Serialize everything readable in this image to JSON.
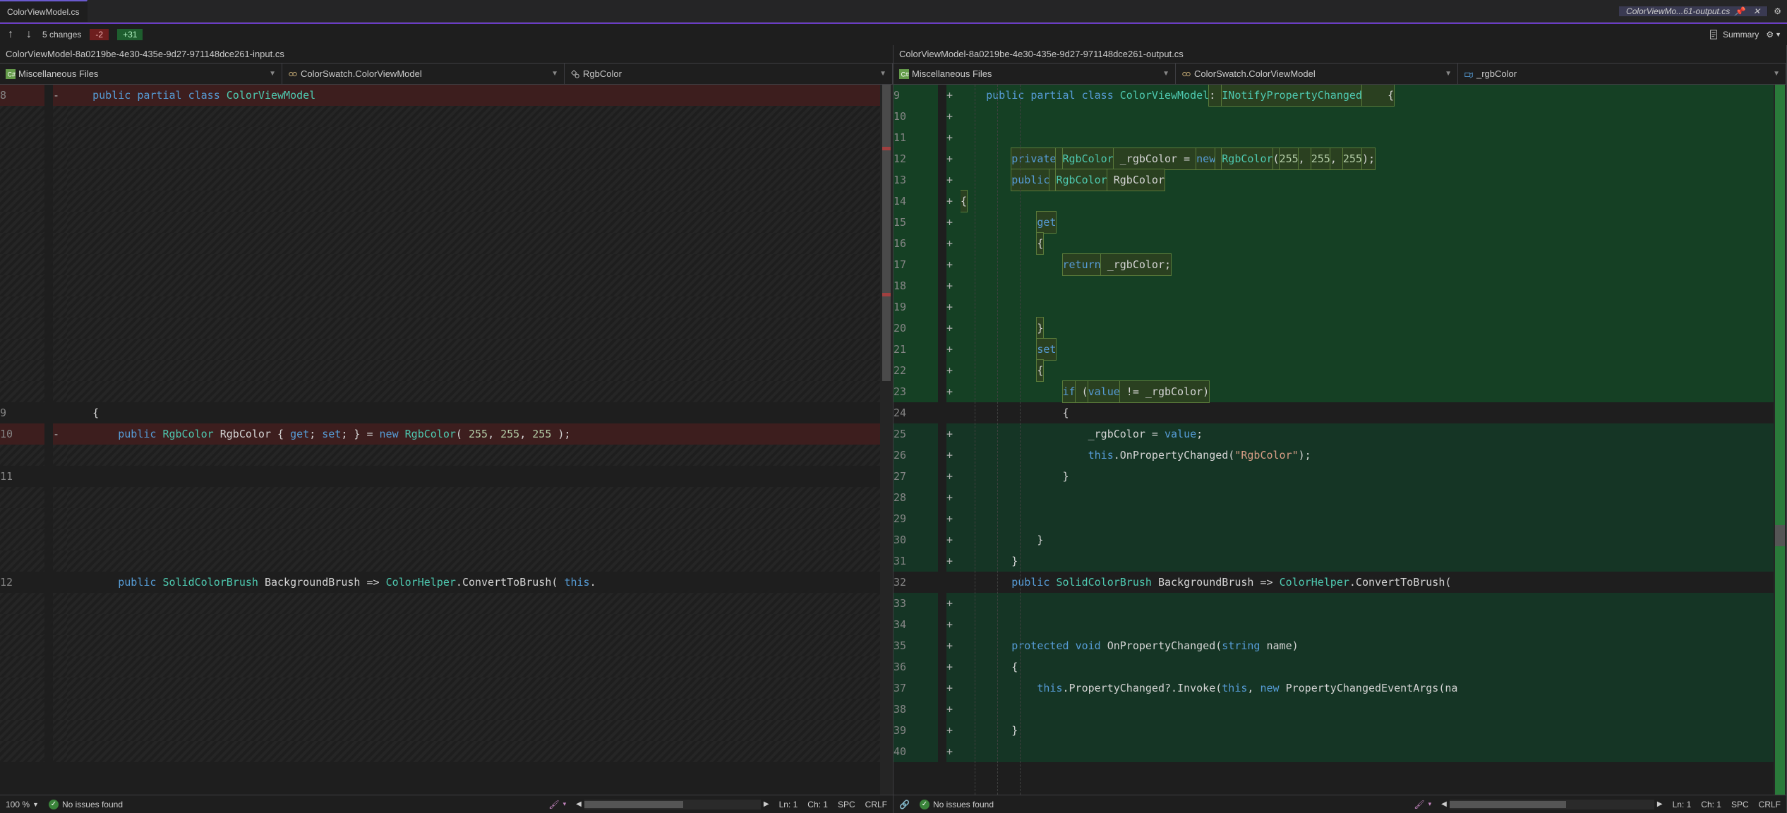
{
  "tabs": {
    "left": {
      "label": "ColorViewModel.cs"
    },
    "right": {
      "label": "ColorViewMo...61-output.cs"
    }
  },
  "toolbar": {
    "changes": "5 changes",
    "removed": "-2",
    "added": "+31",
    "summary": "Summary"
  },
  "headers": {
    "left": "ColorViewModel-8a0219be-4e30-435e-9d27-971148dce261-input.cs",
    "right": "ColorViewModel-8a0219be-4e30-435e-9d27-971148dce261-output.cs"
  },
  "crumbs": {
    "left": {
      "project": "Miscellaneous Files",
      "class": "ColorSwatch.ColorViewModel",
      "member": "RgbColor"
    },
    "right": {
      "project": "Miscellaneous Files",
      "class": "ColorSwatch.ColorViewModel",
      "member": "_rgbColor"
    }
  },
  "left_lines": [
    {
      "n": "8",
      "m": "-",
      "cls": "removed",
      "tokens": [
        [
          "    ",
          ""
        ],
        [
          "public",
          "kw"
        ],
        [
          " ",
          ""
        ],
        [
          "partial",
          "kw"
        ],
        [
          " ",
          ""
        ],
        [
          "class",
          "kw"
        ],
        [
          " ",
          ""
        ],
        [
          "ColorViewModel",
          "type"
        ]
      ]
    },
    {
      "n": "",
      "m": "",
      "cls": "hatch",
      "tokens": []
    },
    {
      "n": "",
      "m": "",
      "cls": "hatch",
      "tokens": []
    },
    {
      "n": "",
      "m": "",
      "cls": "hatch",
      "tokens": []
    },
    {
      "n": "",
      "m": "",
      "cls": "hatch",
      "tokens": []
    },
    {
      "n": "",
      "m": "",
      "cls": "hatch",
      "tokens": []
    },
    {
      "n": "",
      "m": "",
      "cls": "hatch",
      "tokens": []
    },
    {
      "n": "",
      "m": "",
      "cls": "hatch",
      "tokens": []
    },
    {
      "n": "",
      "m": "",
      "cls": "hatch",
      "tokens": []
    },
    {
      "n": "",
      "m": "",
      "cls": "hatch",
      "tokens": []
    },
    {
      "n": "",
      "m": "",
      "cls": "hatch",
      "tokens": []
    },
    {
      "n": "",
      "m": "",
      "cls": "hatch",
      "tokens": []
    },
    {
      "n": "",
      "m": "",
      "cls": "hatch",
      "tokens": []
    },
    {
      "n": "",
      "m": "",
      "cls": "hatch",
      "tokens": []
    },
    {
      "n": "",
      "m": "",
      "cls": "hatch",
      "tokens": []
    },
    {
      "n": "9",
      "m": "",
      "cls": "neutral",
      "tokens": [
        [
          "    {",
          "plain"
        ]
      ]
    },
    {
      "n": "10",
      "m": "-",
      "cls": "removed",
      "tokens": [
        [
          "        ",
          ""
        ],
        [
          "public",
          "kw"
        ],
        [
          " ",
          ""
        ],
        [
          "RgbColor",
          "type"
        ],
        [
          " ",
          ""
        ],
        [
          "RgbColor",
          "plain"
        ],
        [
          " { ",
          "plain"
        ],
        [
          "get",
          "kw"
        ],
        [
          "; ",
          "plain"
        ],
        [
          "set",
          "kw"
        ],
        [
          "; } = ",
          "plain"
        ],
        [
          "new",
          "kw"
        ],
        [
          " ",
          ""
        ],
        [
          "RgbColor",
          "type"
        ],
        [
          "( ",
          "plain"
        ],
        [
          "255",
          "num"
        ],
        [
          ", ",
          "plain"
        ],
        [
          "255",
          "num"
        ],
        [
          ", ",
          "plain"
        ],
        [
          "255",
          "num"
        ],
        [
          " );",
          "plain"
        ]
      ]
    },
    {
      "n": "",
      "m": "",
      "cls": "hatch",
      "tokens": []
    },
    {
      "n": "11",
      "m": "",
      "cls": "neutral",
      "tokens": []
    },
    {
      "n": "",
      "m": "",
      "cls": "hatch",
      "tokens": []
    },
    {
      "n": "",
      "m": "",
      "cls": "hatch",
      "tokens": []
    },
    {
      "n": "",
      "m": "",
      "cls": "hatch",
      "tokens": []
    },
    {
      "n": "",
      "m": "",
      "cls": "hatch",
      "tokens": []
    },
    {
      "n": "12",
      "m": "",
      "cls": "neutral",
      "tokens": [
        [
          "        ",
          ""
        ],
        [
          "public",
          "kw"
        ],
        [
          " ",
          ""
        ],
        [
          "SolidColorBrush",
          "type"
        ],
        [
          " ",
          ""
        ],
        [
          "BackgroundBrush",
          "plain"
        ],
        [
          " => ",
          "plain"
        ],
        [
          "ColorHelper",
          "type"
        ],
        [
          ".",
          "plain"
        ],
        [
          "ConvertToBrush",
          "plain"
        ],
        [
          "( ",
          "plain"
        ],
        [
          "this",
          "kw"
        ],
        [
          ".",
          "plain"
        ]
      ]
    },
    {
      "n": "",
      "m": "",
      "cls": "hatch",
      "tokens": []
    },
    {
      "n": "",
      "m": "",
      "cls": "hatch",
      "tokens": []
    },
    {
      "n": "",
      "m": "",
      "cls": "hatch",
      "tokens": []
    },
    {
      "n": "",
      "m": "",
      "cls": "hatch",
      "tokens": []
    },
    {
      "n": "",
      "m": "",
      "cls": "hatch",
      "tokens": []
    },
    {
      "n": "",
      "m": "",
      "cls": "hatch",
      "tokens": []
    },
    {
      "n": "",
      "m": "",
      "cls": "hatch",
      "tokens": []
    },
    {
      "n": "",
      "m": "",
      "cls": "hatch",
      "tokens": []
    }
  ],
  "right_lines": [
    {
      "n": "9",
      "m": "+",
      "cls": "added",
      "tokens": [
        [
          "    ",
          ""
        ],
        [
          "public",
          "kw"
        ],
        [
          " ",
          ""
        ],
        [
          "partial",
          "kw"
        ],
        [
          " ",
          ""
        ],
        [
          "class",
          "kw"
        ],
        [
          " ",
          ""
        ],
        [
          "ColorViewModel",
          "type"
        ],
        [
          ": ",
          "hl"
        ],
        [
          "INotifyPropertyChanged",
          "hl-type"
        ],
        [
          "    {",
          "hl"
        ]
      ]
    },
    {
      "n": "10",
      "m": "+",
      "cls": "added",
      "tokens": []
    },
    {
      "n": "11",
      "m": "+",
      "cls": "added",
      "tokens": []
    },
    {
      "n": "12",
      "m": "+",
      "cls": "added",
      "tokens": [
        [
          "        ",
          ""
        ],
        [
          "private",
          "hl-kw"
        ],
        [
          " ",
          "hl"
        ],
        [
          "RgbColor",
          "hl-type"
        ],
        [
          " _rgbColor = ",
          "hl"
        ],
        [
          "new",
          "hl-kw"
        ],
        [
          " ",
          "hl"
        ],
        [
          "RgbColor",
          "hl-type"
        ],
        [
          "(",
          "hl"
        ],
        [
          "255",
          "hl-num"
        ],
        [
          ", ",
          "hl"
        ],
        [
          "255",
          "hl-num"
        ],
        [
          ", ",
          "hl"
        ],
        [
          "255",
          "hl-num"
        ],
        [
          ");",
          "hl"
        ]
      ]
    },
    {
      "n": "13",
      "m": "+",
      "cls": "added",
      "tokens": [
        [
          "        ",
          ""
        ],
        [
          "public",
          "hl-kw"
        ],
        [
          " ",
          "hl"
        ],
        [
          "RgbColor",
          "hl-type"
        ],
        [
          " RgbColor",
          "hl"
        ]
      ]
    },
    {
      "n": "14",
      "m": "+",
      "cls": "added",
      "tokens": [
        [
          "{",
          "hl"
        ]
      ]
    },
    {
      "n": "15",
      "m": "+",
      "cls": "added",
      "tokens": [
        [
          "            ",
          ""
        ],
        [
          "get",
          "hl-kw"
        ]
      ]
    },
    {
      "n": "16",
      "m": "+",
      "cls": "added",
      "tokens": [
        [
          "            ",
          ""
        ],
        [
          "{",
          "hl"
        ]
      ]
    },
    {
      "n": "17",
      "m": "+",
      "cls": "added",
      "tokens": [
        [
          "                ",
          ""
        ],
        [
          "return",
          "hl-kw"
        ],
        [
          " _rgbColor;",
          "hl"
        ]
      ]
    },
    {
      "n": "18",
      "m": "+",
      "cls": "added",
      "tokens": []
    },
    {
      "n": "19",
      "m": "+",
      "cls": "added",
      "tokens": []
    },
    {
      "n": "20",
      "m": "+",
      "cls": "added",
      "tokens": [
        [
          "            ",
          ""
        ],
        [
          "}",
          "hl"
        ]
      ]
    },
    {
      "n": "21",
      "m": "+",
      "cls": "added",
      "tokens": [
        [
          "            ",
          ""
        ],
        [
          "set",
          "hl-kw"
        ]
      ]
    },
    {
      "n": "22",
      "m": "+",
      "cls": "added",
      "tokens": [
        [
          "            ",
          ""
        ],
        [
          "{",
          "hl"
        ]
      ]
    },
    {
      "n": "23",
      "m": "+",
      "cls": "added",
      "tokens": [
        [
          "                ",
          ""
        ],
        [
          "if",
          "hl-kw"
        ],
        [
          " (",
          "hl"
        ],
        [
          "value",
          "hl-kw"
        ],
        [
          " != _rgbColor)",
          "hl"
        ]
      ]
    },
    {
      "n": "24",
      "m": "",
      "cls": "neutral",
      "tokens": [
        [
          "                {",
          "plain"
        ]
      ]
    },
    {
      "n": "25",
      "m": "+",
      "cls": "added-scope",
      "tokens": [
        [
          "                    _rgbColor = ",
          "plain"
        ],
        [
          "value",
          "kw"
        ],
        [
          ";",
          "plain"
        ]
      ]
    },
    {
      "n": "26",
      "m": "+",
      "cls": "added-scope",
      "tokens": [
        [
          "                    ",
          ""
        ],
        [
          "this",
          "kw"
        ],
        [
          ".OnPropertyChanged(",
          "plain"
        ],
        [
          "\"RgbColor\"",
          "string"
        ],
        [
          ");",
          "plain"
        ]
      ]
    },
    {
      "n": "27",
      "m": "+",
      "cls": "added-scope",
      "tokens": [
        [
          "                }",
          "plain"
        ]
      ]
    },
    {
      "n": "28",
      "m": "+",
      "cls": "added-scope",
      "tokens": []
    },
    {
      "n": "29",
      "m": "+",
      "cls": "added-scope",
      "tokens": []
    },
    {
      "n": "30",
      "m": "+",
      "cls": "added-scope",
      "tokens": [
        [
          "            }",
          "plain"
        ]
      ]
    },
    {
      "n": "31",
      "m": "+",
      "cls": "added-scope",
      "tokens": [
        [
          "        }",
          "plain"
        ]
      ]
    },
    {
      "n": "32",
      "m": "",
      "cls": "neutral",
      "tokens": [
        [
          "        ",
          ""
        ],
        [
          "public",
          "kw"
        ],
        [
          " ",
          ""
        ],
        [
          "SolidColorBrush",
          "type"
        ],
        [
          " BackgroundBrush => ",
          "plain"
        ],
        [
          "ColorHelper",
          "type"
        ],
        [
          ".ConvertToBrush(",
          "plain"
        ]
      ]
    },
    {
      "n": "33",
      "m": "+",
      "cls": "added-scope",
      "tokens": []
    },
    {
      "n": "34",
      "m": "+",
      "cls": "added-scope",
      "tokens": []
    },
    {
      "n": "35",
      "m": "+",
      "cls": "added-scope",
      "tokens": [
        [
          "        ",
          ""
        ],
        [
          "protected",
          "kw"
        ],
        [
          " ",
          ""
        ],
        [
          "void",
          "kw"
        ],
        [
          " OnPropertyChanged(",
          "plain"
        ],
        [
          "string",
          "kw"
        ],
        [
          " name)",
          "plain"
        ]
      ]
    },
    {
      "n": "36",
      "m": "+",
      "cls": "added-scope",
      "tokens": [
        [
          "        {",
          "plain"
        ]
      ]
    },
    {
      "n": "37",
      "m": "+",
      "cls": "added-scope",
      "tokens": [
        [
          "            ",
          ""
        ],
        [
          "this",
          "kw"
        ],
        [
          ".PropertyChanged?.Invoke(",
          "plain"
        ],
        [
          "this",
          "kw"
        ],
        [
          ", ",
          "plain"
        ],
        [
          "new",
          "kw"
        ],
        [
          " PropertyChangedEventArgs(na",
          "plain"
        ]
      ]
    },
    {
      "n": "38",
      "m": "+",
      "cls": "added-scope",
      "tokens": []
    },
    {
      "n": "39",
      "m": "+",
      "cls": "added-scope",
      "tokens": [
        [
          "        }",
          "plain"
        ]
      ]
    },
    {
      "n": "40",
      "m": "+",
      "cls": "added-scope",
      "tokens": []
    }
  ],
  "status": {
    "zoom": "100 %",
    "issues": "No issues found",
    "ln": "Ln: 1",
    "ch": "Ch: 1",
    "spc": "SPC",
    "crlf": "CRLF"
  }
}
